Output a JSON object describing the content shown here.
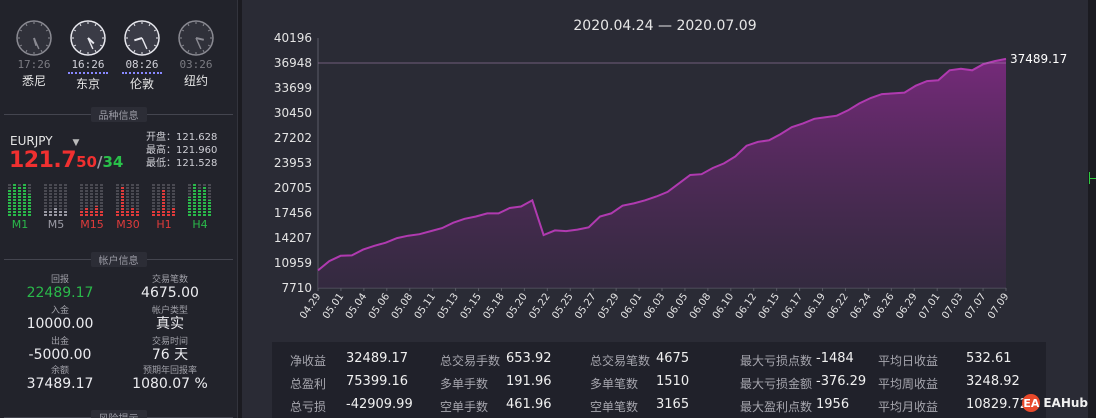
{
  "clocks": [
    {
      "time": "17:26",
      "city": "悉尼",
      "active": false,
      "hour": 5,
      "minute": 26
    },
    {
      "time": "16:26",
      "city": "东京",
      "active": true,
      "hour": 4,
      "minute": 26
    },
    {
      "time": "08:26",
      "city": "伦敦",
      "active": true,
      "hour": 8,
      "minute": 26
    },
    {
      "time": "03:26",
      "city": "纽约",
      "active": false,
      "hour": 3,
      "minute": 26
    }
  ],
  "sections": {
    "instrument": "品种信息",
    "account": "帐户信息",
    "next": "风险提示"
  },
  "symbol": {
    "name": "EURJPY",
    "bid_big": "121.7",
    "bid_small": "50",
    "sep": "/",
    "ask_small": "34"
  },
  "ohl": {
    "open": "开盘：121.628",
    "high": "最高：121.960",
    "low": "最低：121.528"
  },
  "timeframes": [
    {
      "name": "M1",
      "color": "#2ab94a",
      "levels": [
        0.8,
        1.0,
        0.9,
        1.0,
        0.7
      ]
    },
    {
      "name": "M5",
      "color": "#9a9aa4",
      "levels": [
        0.2,
        0.2,
        0.25,
        0.2,
        0.2
      ]
    },
    {
      "name": "M15",
      "color": "#e03b3b",
      "levels": [
        0.2,
        0.25,
        0.2,
        0.3,
        0.2
      ]
    },
    {
      "name": "M30",
      "color": "#e03b3b",
      "levels": [
        0.2,
        0.9,
        0.2,
        0.25,
        0.2
      ]
    },
    {
      "name": "H1",
      "color": "#e03b3b",
      "levels": [
        0.2,
        0.2,
        0.8,
        0.2,
        0.25
      ]
    },
    {
      "name": "H4",
      "color": "#2ab94a",
      "levels": [
        0.6,
        1.0,
        0.8,
        0.9,
        0.5
      ]
    }
  ],
  "account": {
    "return_cap": "回报",
    "return_val": "22489.17",
    "trades_cap": "交易笔数",
    "trades_val": "4675.00",
    "deposit_cap": "入金",
    "deposit_val": "10000.00",
    "type_cap": "帐户类型",
    "type_val": "真实",
    "withdraw_cap": "出金",
    "withdraw_val": "-5000.00",
    "time_cap": "交易时间",
    "time_val": "76 天",
    "balance_cap": "余额",
    "balance_val": "37489.17",
    "annual_cap": "预期年回报率",
    "annual_val": "1080.07 %"
  },
  "chart_title": "2020.04.24 — 2020.07.09",
  "chart_data": {
    "type": "area",
    "title": "2020.04.24 — 2020.07.09",
    "ylim": [
      7710,
      40196
    ],
    "yticks": [
      40196,
      36948,
      33699,
      30450,
      27202,
      23953,
      20705,
      17456,
      14207,
      10959,
      7710
    ],
    "xticks": [
      "04.29",
      "05.01",
      "05.04",
      "05.06",
      "05.08",
      "05.11",
      "05.13",
      "05.15",
      "05.18",
      "05.20",
      "05.22",
      "05.25",
      "05.27",
      "05.29",
      "06.01",
      "06.03",
      "06.05",
      "06.08",
      "06.10",
      "06.12",
      "06.15",
      "06.17",
      "06.19",
      "06.22",
      "06.24",
      "06.26",
      "06.29",
      "07.01",
      "07.03",
      "07.07",
      "07.09"
    ],
    "last_value": "37489.17",
    "series": [
      {
        "values": [
          10000,
          11200,
          11900,
          11950,
          12700,
          13200,
          13600,
          14200,
          14500,
          14700,
          15100,
          15500,
          16200,
          16700,
          17000,
          17400,
          17400,
          18100,
          18300,
          19100,
          14600,
          15200,
          15100,
          15300,
          15600,
          17000,
          17400,
          18400,
          18700,
          19100,
          19600,
          20200,
          21300,
          22400,
          22500,
          23300,
          23900,
          24800,
          26200,
          26700,
          26900,
          27700,
          28600,
          29100,
          29700,
          29900,
          30100,
          30800,
          31700,
          32400,
          32900,
          33000,
          33100,
          34000,
          34600,
          34700,
          36000,
          36200,
          36000,
          36800,
          37200,
          37489.17
        ]
      }
    ],
    "ref_line": 36948,
    "grid": false,
    "line_color": "#b03ab0"
  },
  "stats": [
    {
      "k": "净收益",
      "v": "32489.17"
    },
    {
      "k": "总盈利",
      "v": "75399.16"
    },
    {
      "k": "总亏损",
      "v": "-42909.99"
    },
    {
      "k": "总交易手数",
      "v": "653.92"
    },
    {
      "k": "多单手数",
      "v": "191.96"
    },
    {
      "k": "空单手数",
      "v": "461.96"
    },
    {
      "k": "总交易笔数",
      "v": "4675"
    },
    {
      "k": "多单笔数",
      "v": "1510"
    },
    {
      "k": "空单笔数",
      "v": "3165"
    },
    {
      "k": "最大亏损点数",
      "v": "-1484"
    },
    {
      "k": "最大亏损金额",
      "v": "-376.29"
    },
    {
      "k": "最大盈利点数",
      "v": "1956"
    },
    {
      "k": "平均日收益",
      "v": "532.61"
    },
    {
      "k": "平均周收益",
      "v": "3248.92"
    },
    {
      "k": "平均月收益",
      "v": "10829.72"
    }
  ],
  "logo": {
    "badge": "EA",
    "text": "EAHub"
  }
}
